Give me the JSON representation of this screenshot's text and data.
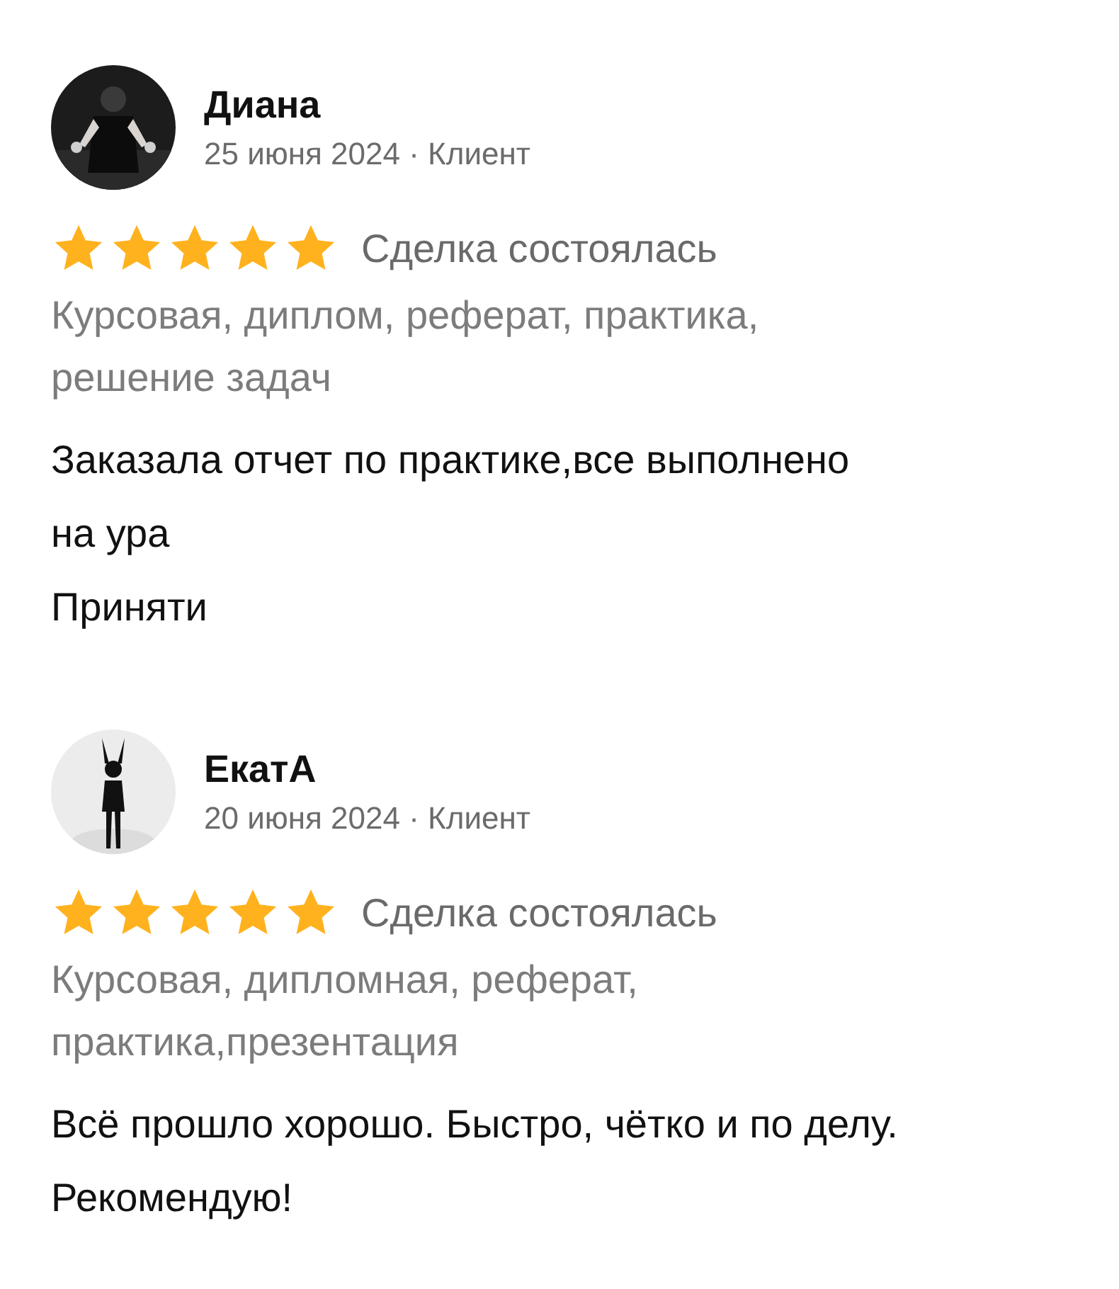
{
  "reviews": [
    {
      "author": "Диана",
      "date": "25 июня 2024 · Клиент",
      "stars": 5,
      "deal_status": "Сделка состоялась",
      "category": "Курсовая, диплом, реферат, практика, решение задач",
      "paragraphs": [
        "Заказала отчет по практике,все выполнено на ура",
        "Приняти"
      ]
    },
    {
      "author": "ЕкатА",
      "date": "20 июня 2024 · Клиент",
      "stars": 5,
      "deal_status": "Сделка состоялась",
      "category": "Курсовая, дипломная, реферат, практика,презентация",
      "paragraphs": [
        "Всё прошло хорошо. Быстро, чётко и по делу. Рекомендую!"
      ]
    }
  ]
}
